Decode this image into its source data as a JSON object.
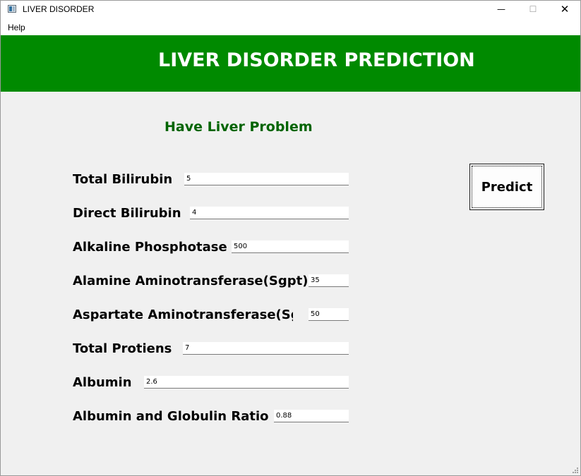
{
  "window": {
    "title": "LIVER DISORDER",
    "minimize_glyph": "—",
    "maximize_glyph": "☐",
    "close_glyph": "✕",
    "icon": "app-window-icon"
  },
  "menu": {
    "items": [
      {
        "label": "Help"
      }
    ]
  },
  "banner": {
    "title": "LIVER DISORDER PREDICTION",
    "color": "#008a00"
  },
  "result": {
    "text": "Have Liver Problem",
    "color": "#006400"
  },
  "predict_button": {
    "label": "Predict"
  },
  "fields": [
    {
      "label": "Total Bilirubin",
      "value": "5"
    },
    {
      "label": "Direct Bilirubin",
      "value": "4"
    },
    {
      "label": "Alkaline Phosphotase",
      "value": "500"
    },
    {
      "label": "Alamine Aminotransferase(Sgpt)",
      "value": "35"
    },
    {
      "label": "Aspartate Aminotransferase(Sgot)",
      "value": "50"
    },
    {
      "label": "Total Protiens",
      "value": "7"
    },
    {
      "label": "Albumin",
      "value": "2.6"
    },
    {
      "label": "Albumin and Globulin Ratio",
      "value": "0.88"
    }
  ]
}
